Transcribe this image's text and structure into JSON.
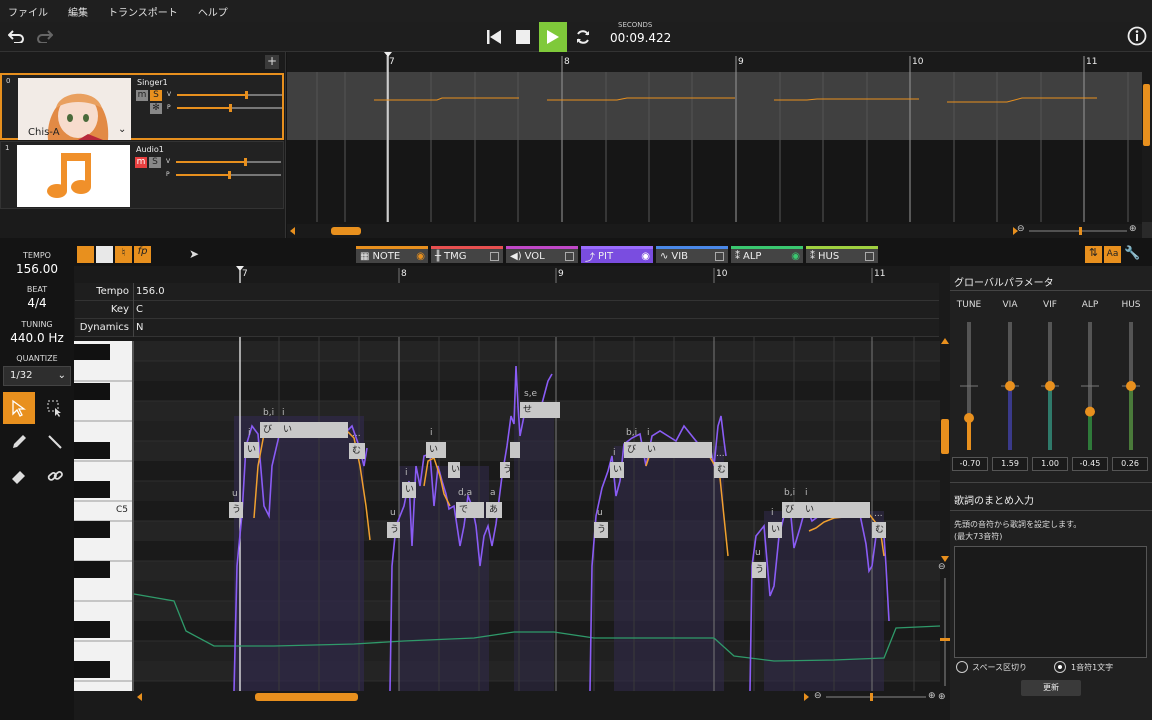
{
  "menu": [
    "ファイル",
    "編集",
    "トランスポート",
    "ヘルプ"
  ],
  "transport": {
    "time_label": "SECONDS",
    "time": "00:09.422"
  },
  "tracks": [
    {
      "index": "0",
      "name": "Singer1",
      "image_label": "Chis-A",
      "m": "m",
      "s": "S",
      "v": "V",
      "p": "P"
    },
    {
      "index": "1",
      "name": "Audio1",
      "m": "m",
      "s": "S",
      "v": "V",
      "p": "P"
    }
  ],
  "measures": [
    "7",
    "8",
    "9",
    "10",
    "11"
  ],
  "tabs": {
    "note": "NOTE",
    "tmg": "TMG",
    "vol": "VOL",
    "pit": "PIT",
    "vib": "VIB",
    "alp": "ALP",
    "hus": "HUS"
  },
  "left": {
    "tempo_label": "TEMPO",
    "tempo": "156.00",
    "beat_label": "BEAT",
    "beat": "4/4",
    "tuning_label": "TUNING",
    "tuning": "440.0 Hz",
    "quantize_label": "QUANTIZE",
    "quantize": "1/32"
  },
  "params": {
    "tempo_key": "Tempo",
    "tempo_val": "156.0",
    "key_key": "Key",
    "key_val": "C",
    "dyn_key": "Dynamics",
    "dyn_val": "N"
  },
  "piano": {
    "c5": "C5"
  },
  "notes": [
    {
      "lyric": "う",
      "phon": "u"
    },
    {
      "lyric": "い",
      "phon": "i"
    },
    {
      "lyric": "び",
      "phon": "b,i"
    },
    {
      "lyric": "い",
      "phon": "i"
    },
    {
      "lyric": "…",
      "phon": "..."
    },
    {
      "lyric": "む",
      "phon": ""
    },
    {
      "lyric": "う",
      "phon": "u"
    },
    {
      "lyric": "い",
      "phon": "i"
    },
    {
      "lyric": "い",
      "phon": "i"
    },
    {
      "lyric": "い",
      "phon": ""
    },
    {
      "lyric": "で",
      "phon": "d,a"
    },
    {
      "lyric": "あ",
      "phon": "a"
    },
    {
      "lyric": "う",
      "phon": ""
    },
    {
      "lyric": "せ",
      "phon": "s,e"
    },
    {
      "lyric": "う",
      "phon": "u"
    },
    {
      "lyric": "い",
      "phon": "i"
    },
    {
      "lyric": "び",
      "phon": "b,i"
    },
    {
      "lyric": "い",
      "phon": "i"
    },
    {
      "lyric": "…",
      "phon": "..."
    },
    {
      "lyric": "む",
      "phon": ""
    },
    {
      "lyric": "う",
      "phon": "u"
    },
    {
      "lyric": "い",
      "phon": "i"
    },
    {
      "lyric": "び",
      "phon": "b,i"
    },
    {
      "lyric": "い",
      "phon": "i"
    },
    {
      "lyric": "…",
      "phon": "..."
    },
    {
      "lyric": "む",
      "phon": ""
    }
  ],
  "global": {
    "title": "グローバルパラメータ",
    "cols": [
      {
        "name": "TUNE",
        "value": "-0.70"
      },
      {
        "name": "VIA",
        "value": "1.59"
      },
      {
        "name": "VIF",
        "value": "1.00"
      },
      {
        "name": "ALP",
        "value": "-0.45"
      },
      {
        "name": "HUS",
        "value": "0.26"
      }
    ],
    "levels": [
      0.25,
      0.5,
      0.5,
      0.3,
      0.5
    ],
    "lyric_title": "歌詞のまとめ入力",
    "lyric_desc1": "先頭の音符から歌詞を設定します。",
    "lyric_desc2": "(最大73音符)",
    "radio1": "スペース区切り",
    "radio2": "1音符1文字",
    "update": "更新"
  },
  "colors": {
    "accent": "#e8901e",
    "pitch": "#8a5cf5",
    "pitch_orange": "#f0a030",
    "tension": "#2f9a6a"
  }
}
